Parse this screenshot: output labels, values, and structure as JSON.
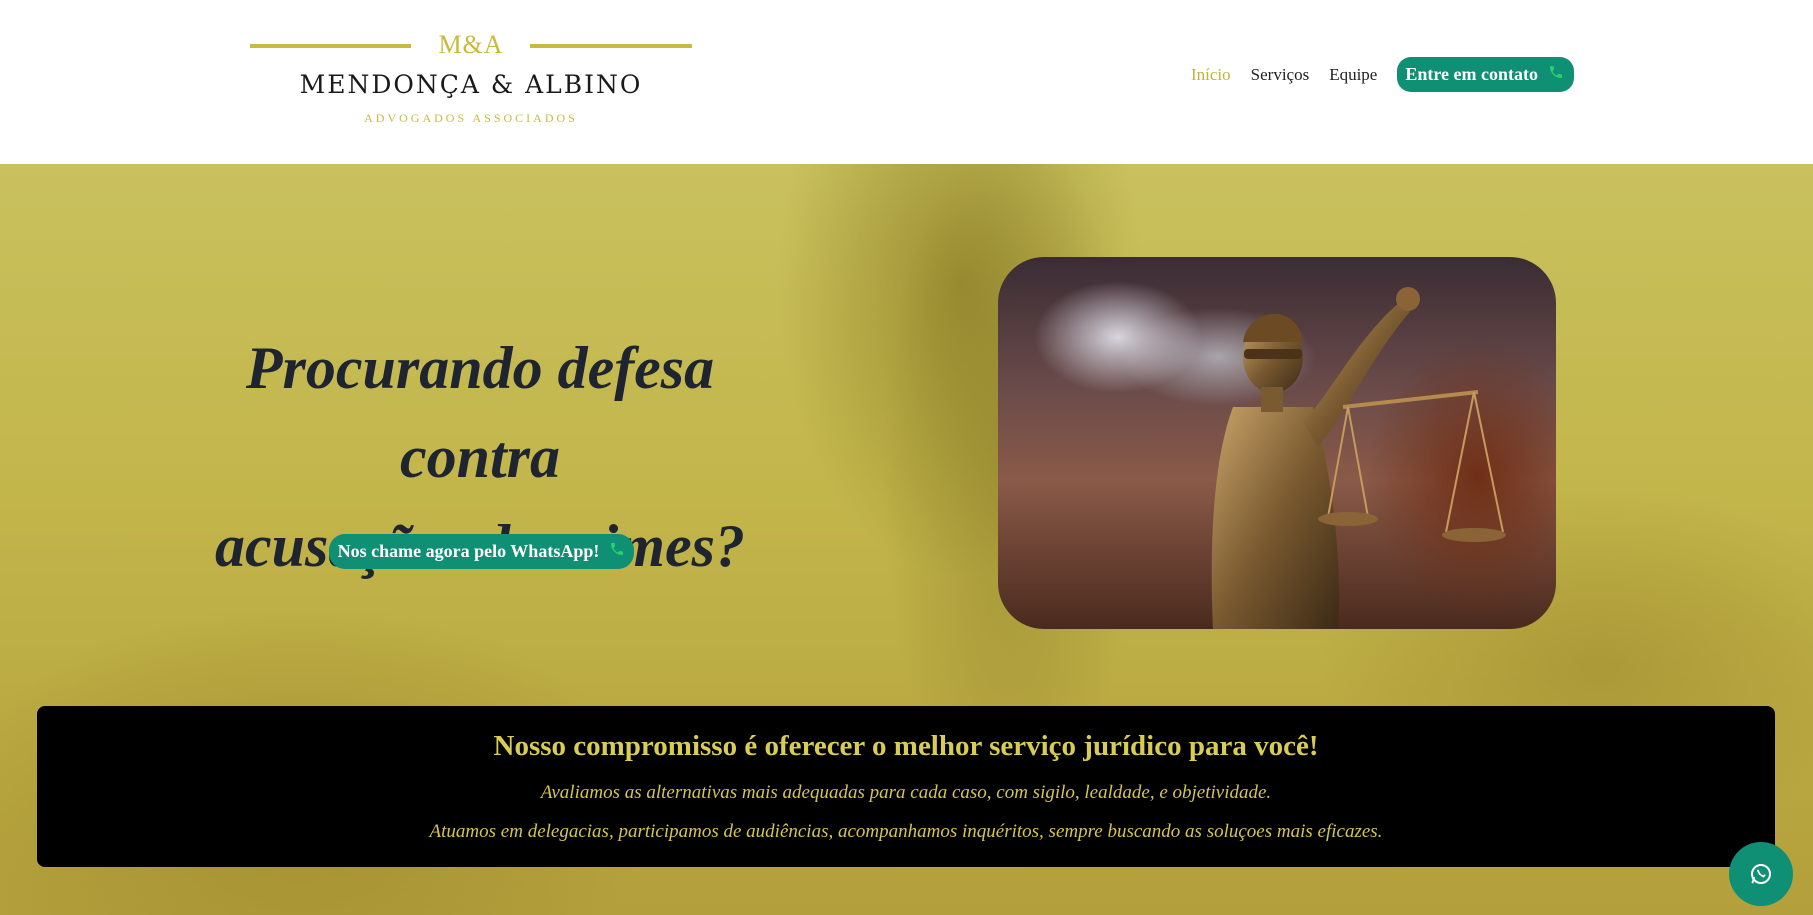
{
  "logo": {
    "mark": "M&A",
    "name": "MENDONÇA & ALBINO",
    "subtitle": "ADVOGADOS ASSOCIADOS"
  },
  "nav": {
    "items": [
      {
        "label": "Início",
        "active": true
      },
      {
        "label": "Serviços",
        "active": false
      },
      {
        "label": "Equipe",
        "active": false
      }
    ],
    "contact_button": "Entre em contato"
  },
  "hero": {
    "title_line1": "Procurando defesa contra",
    "title_line2": "acusações de crimes?",
    "whatsapp_button": "Nos chame agora pelo WhatsApp!"
  },
  "commitment": {
    "heading": "Nosso compromisso é oferecer o melhor serviço jurídico para você!",
    "line1": "Avaliamos as alternativas mais adequadas para cada caso, com sigilo, lealdade, e objetividade.",
    "line2": "Atuamos em delegacias, participamos de audiências, acompanhamos inquéritos, sempre buscando as soluçoes mais eficazes."
  },
  "icons": {
    "phone": "phone-icon",
    "whatsapp": "whatsapp-icon"
  },
  "colors": {
    "accent_gold": "#c8bb3c",
    "whatsapp_green": "#0f8f74",
    "phone_green": "#25d366"
  }
}
